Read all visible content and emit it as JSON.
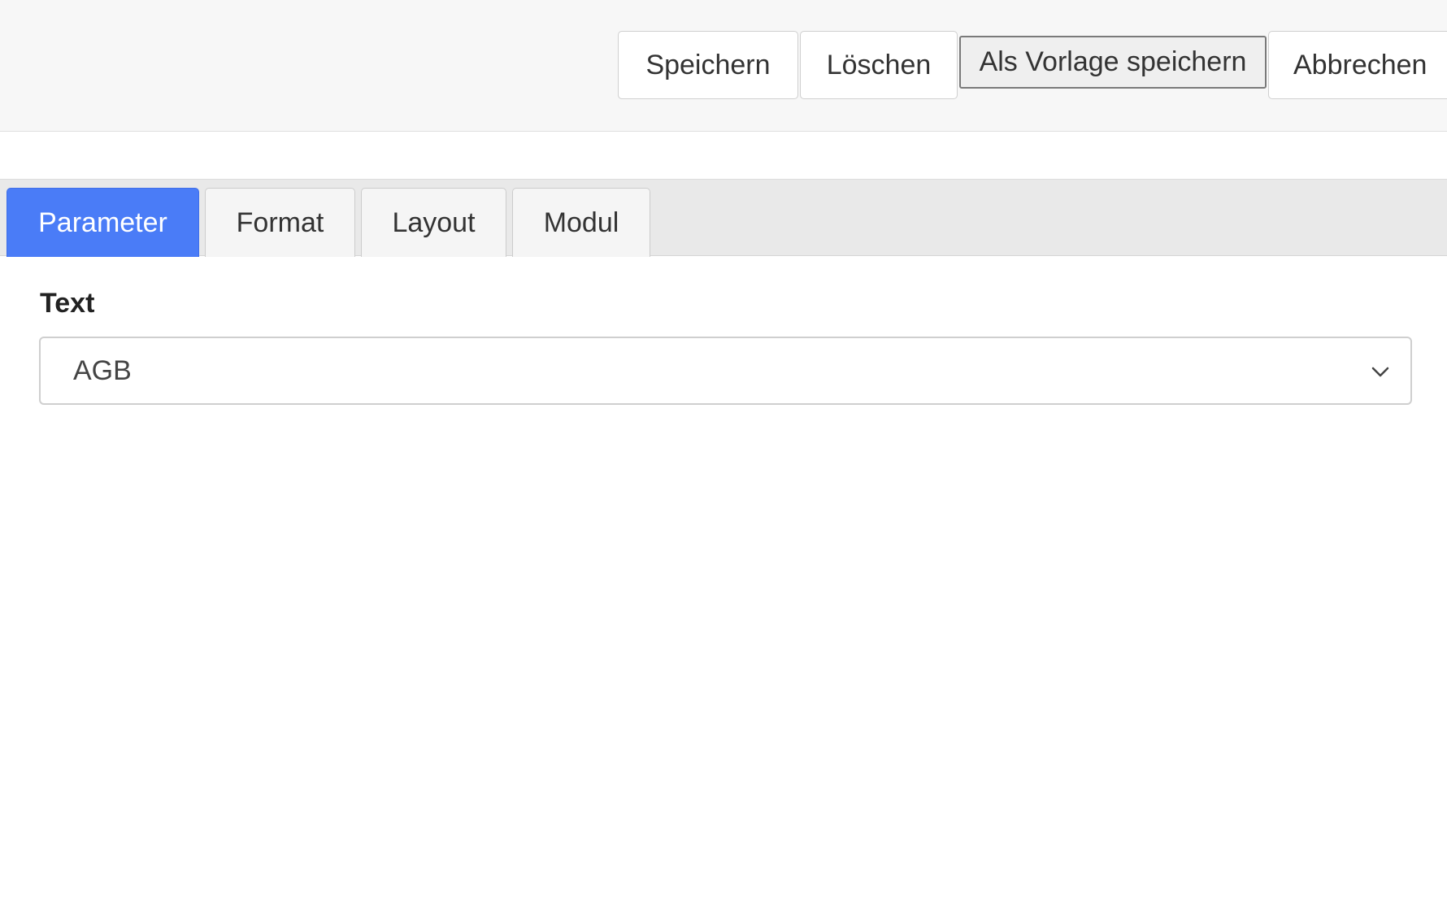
{
  "toolbar": {
    "save_label": "Speichern",
    "delete_label": "Löschen",
    "save_template_label": "Als Vorlage speichern",
    "cancel_label": "Abbrechen"
  },
  "tabs": [
    {
      "label": "Parameter",
      "active": true
    },
    {
      "label": "Format",
      "active": false
    },
    {
      "label": "Layout",
      "active": false
    },
    {
      "label": "Modul",
      "active": false
    }
  ],
  "form": {
    "text_field": {
      "label": "Text",
      "selected_value": "AGB",
      "icon": "chevron-down-icon"
    }
  },
  "colors": {
    "active_tab": "#4a7cf7",
    "toolbar_bg": "#f7f7f7",
    "tabbar_bg": "#e9e9e9"
  }
}
